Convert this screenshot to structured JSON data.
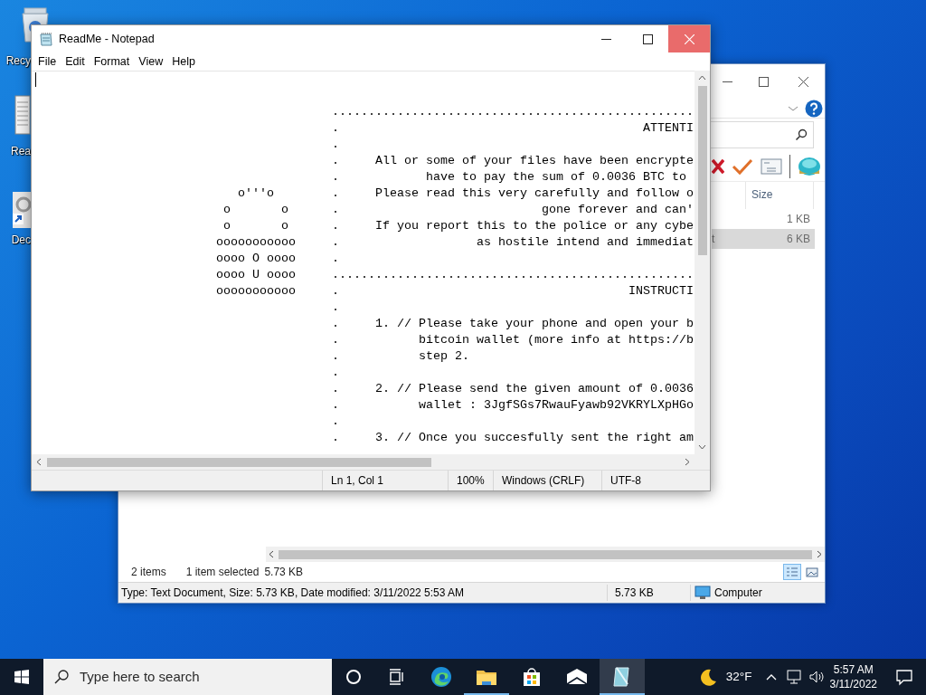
{
  "desktop_icons": [
    {
      "kind": "recycle-bin",
      "label": "Recy"
    },
    {
      "kind": "document",
      "label": "Rea"
    },
    {
      "kind": "shortcut",
      "label": "Dec"
    }
  ],
  "explorer": {
    "column_header": "Size",
    "rows": [
      {
        "size": "1 KB",
        "selected": false
      },
      {
        "name": "t",
        "size": "6 KB",
        "selected": true
      }
    ],
    "item_count": "2 items",
    "selection_count": "1 item selected",
    "selection_size": "5.73 KB",
    "view_buttons": [
      {
        "kind": "details",
        "selected": true
      },
      {
        "kind": "large-icons",
        "selected": false
      }
    ],
    "details": "Type: Text Document, Size: 5.73 KB, Date modified: 3/11/2022 5:53 AM",
    "details_size": "5.73 KB",
    "location": "Computer"
  },
  "notepad": {
    "title": "ReadMe - Notepad",
    "menu": [
      "File",
      "Edit",
      "Format",
      "View",
      "Help"
    ],
    "lines": [
      {
        "text": ".................................................."
      },
      {
        "text": ".                                          ATTENTI"
      },
      {
        "text": "."
      },
      {
        "text": ".     All or some of your files have been encrypte"
      },
      {
        "text": ".            have to pay the sum of 0.0036 BTC to"
      },
      {
        "art": "   o'''o",
        "text": ".     Please read this very carefully and follow o"
      },
      {
        "art": " o       o",
        "text": ".                            gone forever and can'"
      },
      {
        "art": " o       o",
        "text": ".     If you report this to the police or any cybe"
      },
      {
        "art": "ooooooooooo",
        "text": ".                   as hostile intend and immediat"
      },
      {
        "art": "oooo O oooo",
        "text": "."
      },
      {
        "art": "oooo U oooo",
        "text": ".................................................."
      },
      {
        "art": "ooooooooooo",
        "text": ".                                        INSTRUCTI"
      },
      {
        "text": "."
      },
      {
        "text": ".     1. // Please take your phone and open your b"
      },
      {
        "text": ".           bitcoin wallet (more info at https://b"
      },
      {
        "text": ".           step 2."
      },
      {
        "text": "."
      },
      {
        "text": ".     2. // Please send the given amount of 0.0036"
      },
      {
        "text": ".           wallet : 3JgfSGs7RwauFyawb92VKRYLXpHGo"
      },
      {
        "text": "."
      },
      {
        "text": ".     3. // Once you succesfully sent the right am"
      }
    ],
    "status": [
      "Ln 1, Col 1",
      "100%",
      "Windows (CRLF)",
      "UTF-8"
    ]
  },
  "taskbar": {
    "search_placeholder": "Type here to search",
    "apps": [
      {
        "kind": "edge",
        "running": false,
        "selected": false
      },
      {
        "kind": "explorer",
        "running": true,
        "selected": false
      },
      {
        "kind": "store",
        "running": false,
        "selected": false
      },
      {
        "kind": "mail",
        "running": false,
        "selected": false
      },
      {
        "kind": "notepad",
        "running": true,
        "selected": true
      }
    ],
    "temperature": "32°F",
    "time": "5:57 AM",
    "date": "3/11/2022"
  }
}
